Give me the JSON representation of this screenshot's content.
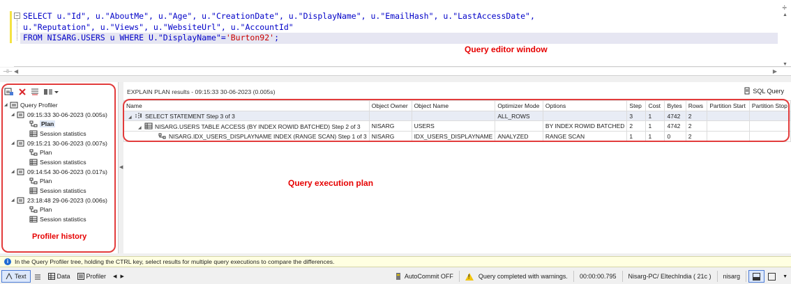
{
  "editor": {
    "collapse_glyph": "⊟",
    "line1_kw": "SELECT",
    "line1_rest": " u.\"Id\", u.\"AboutMe\", u.\"Age\", u.\"CreationDate\", u.\"DisplayName\", u.\"EmailHash\", u.\"LastAccessDate\",",
    "line2": "u.\"Reputation\", u.\"Views\", u.\"WebsiteUrl\", u.\"AccountId\"",
    "line3_kw1": "FROM",
    "line3_mid": " NISARG.USERS u ",
    "line3_kw2": "WHERE",
    "line3_col": " U.\"DisplayName\"=",
    "line3_str": "'Burton92'",
    "line3_end": ";",
    "annotation": "Query editor window",
    "top_icon": "÷"
  },
  "profiler": {
    "toolbar_icons": [
      "profiler-tree-icon",
      "delete-icon",
      "filter-icon",
      "compare-icon"
    ],
    "root_label": "Query Profiler",
    "sessions": [
      {
        "label": "09:15:33 30-06-2023 (0.005s)",
        "plan": "Plan",
        "stats": "Session statistics"
      },
      {
        "label": "09:15:21 30-06-2023 (0.007s)",
        "plan": "Plan",
        "stats": "Session statistics"
      },
      {
        "label": "09:14:54 30-06-2023 (0.017s)",
        "plan": "Plan",
        "stats": "Session statistics"
      },
      {
        "label": "23:18:48 29-06-2023 (0.006s)",
        "plan": "Plan",
        "stats": "Session statistics"
      }
    ],
    "annotation": "Profiler history"
  },
  "results": {
    "header": "EXPLAIN PLAN results - 09:15:33 30-06-2023 (0.005s)",
    "sql_query_label": "SQL Query",
    "columns": [
      "Name",
      "Object Owner",
      "Object Name",
      "Optimizer Mode",
      "Options",
      "Step",
      "Cost",
      "Bytes",
      "Rows",
      "Partition Start",
      "Partition Stop"
    ],
    "rows": [
      [
        "SELECT STATEMENT Step 3 of 3",
        "",
        "",
        "ALL_ROWS",
        "",
        "3",
        "1",
        "4742",
        "2",
        "",
        ""
      ],
      [
        "NISARG.USERS TABLE ACCESS (BY INDEX ROWID BATCHED) Step 2 of 3",
        "NISARG",
        "USERS",
        "",
        "BY INDEX ROWID BATCHED",
        "2",
        "1",
        "4742",
        "2",
        "",
        ""
      ],
      [
        "NISARG.IDX_USERS_DISPLAYNAME INDEX (RANGE SCAN) Step 1 of 3",
        "NISARG",
        "IDX_USERS_DISPLAYNAME",
        "ANALYZED",
        "RANGE SCAN",
        "1",
        "1",
        "0",
        "2",
        "",
        ""
      ]
    ],
    "annotation": "Query execution plan"
  },
  "infobar": {
    "text": "In the Query Profiler tree, holding the CTRL key, select results for multiple query executions to compare the differences."
  },
  "status": {
    "text_tab": "Text",
    "data_tab": "Data",
    "profiler_tab": "Profiler",
    "autocommit": "AutoCommit OFF",
    "message": "Query completed with warnings.",
    "elapsed": "00:00:00.795",
    "connection": "Nisarg-PC/ EltechIndia ( 21c )",
    "user": "nisarg"
  },
  "colors": {
    "annotation_red": "#e60000",
    "keyword_blue": "#0000c8",
    "string_red": "#c80000"
  }
}
